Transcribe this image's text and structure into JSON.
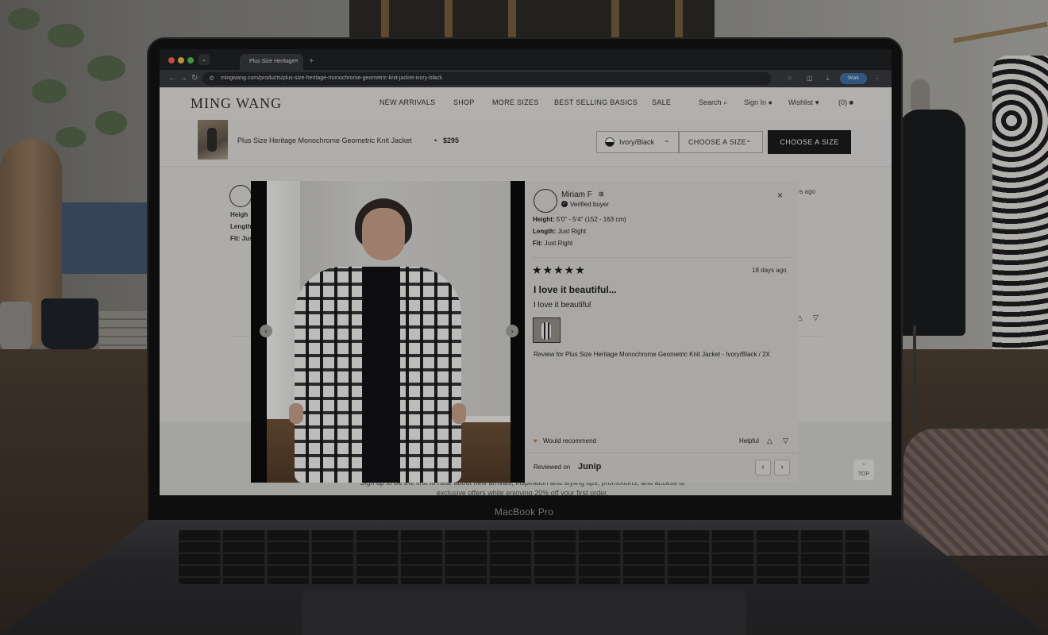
{
  "browser": {
    "tab_title": "Plus Size Heritage",
    "tab_close": "×",
    "new_tab": "+",
    "url": "mingwang.com/products/plus-size-heritage-monochrome-geometric-knit-jacket-ivory-black",
    "profile_label": "Work",
    "nav_back": "←",
    "nav_forward": "→",
    "nav_reload": "↻"
  },
  "site": {
    "logo": "MING WANG",
    "nav": [
      "NEW ARRIVALS",
      "SHOP",
      "MORE SIZES",
      "BEST SELLING BASICS",
      "SALE"
    ],
    "utils": {
      "search": "Search",
      "sign_in": "Sign In",
      "wishlist": "Wishlist",
      "cart": "(0)"
    }
  },
  "product_bar": {
    "title": "Plus Size Heritage Monochrome Geometric Knit Jacket",
    "separator": "•",
    "price": "$295",
    "variant": "Ivory/Black",
    "size_select": "CHOOSE A SIZE",
    "cta": "CHOOSE A SIZE"
  },
  "background_review": {
    "lines": [
      "Heigh",
      "Length",
      "Fit: Jus"
    ],
    "time_fragment": "ays ago"
  },
  "review_modal": {
    "reviewer": "Miriam F",
    "verified": "Verified buyer",
    "attributes": [
      {
        "label": "Height:",
        "value": "5'0\" - 5'4\" (152 - 163 cm)"
      },
      {
        "label": "Length:",
        "value": "Just Right"
      },
      {
        "label": "Fit:",
        "value": "Just Right"
      }
    ],
    "rating": 5,
    "stars": "★★★★★",
    "date": "18 days ago",
    "title": "I love it beautiful...",
    "body": "I love it beautiful",
    "review_for": "Review for Plus Size Heritage Monochrome Geometric Knit Jacket - Ivory/Black / 2X",
    "recommend": "Would recommend",
    "helpful": "Helpful",
    "reviewed_on": "Reviewed on",
    "provider": "Junip",
    "close": "×",
    "prev": "‹",
    "next": "›"
  },
  "footer": {
    "text": "Sign up to be the first to hear about new arrivals, inspiration and styling tips, promotions, and access to exclusive offers while enjoying 20% off your first order.",
    "top_label": "TOP"
  },
  "laptop": {
    "brand": "MacBook Pro"
  },
  "colors": {
    "accent_dark": "#1a1a1a",
    "recommend_heart": "#d2642e"
  }
}
